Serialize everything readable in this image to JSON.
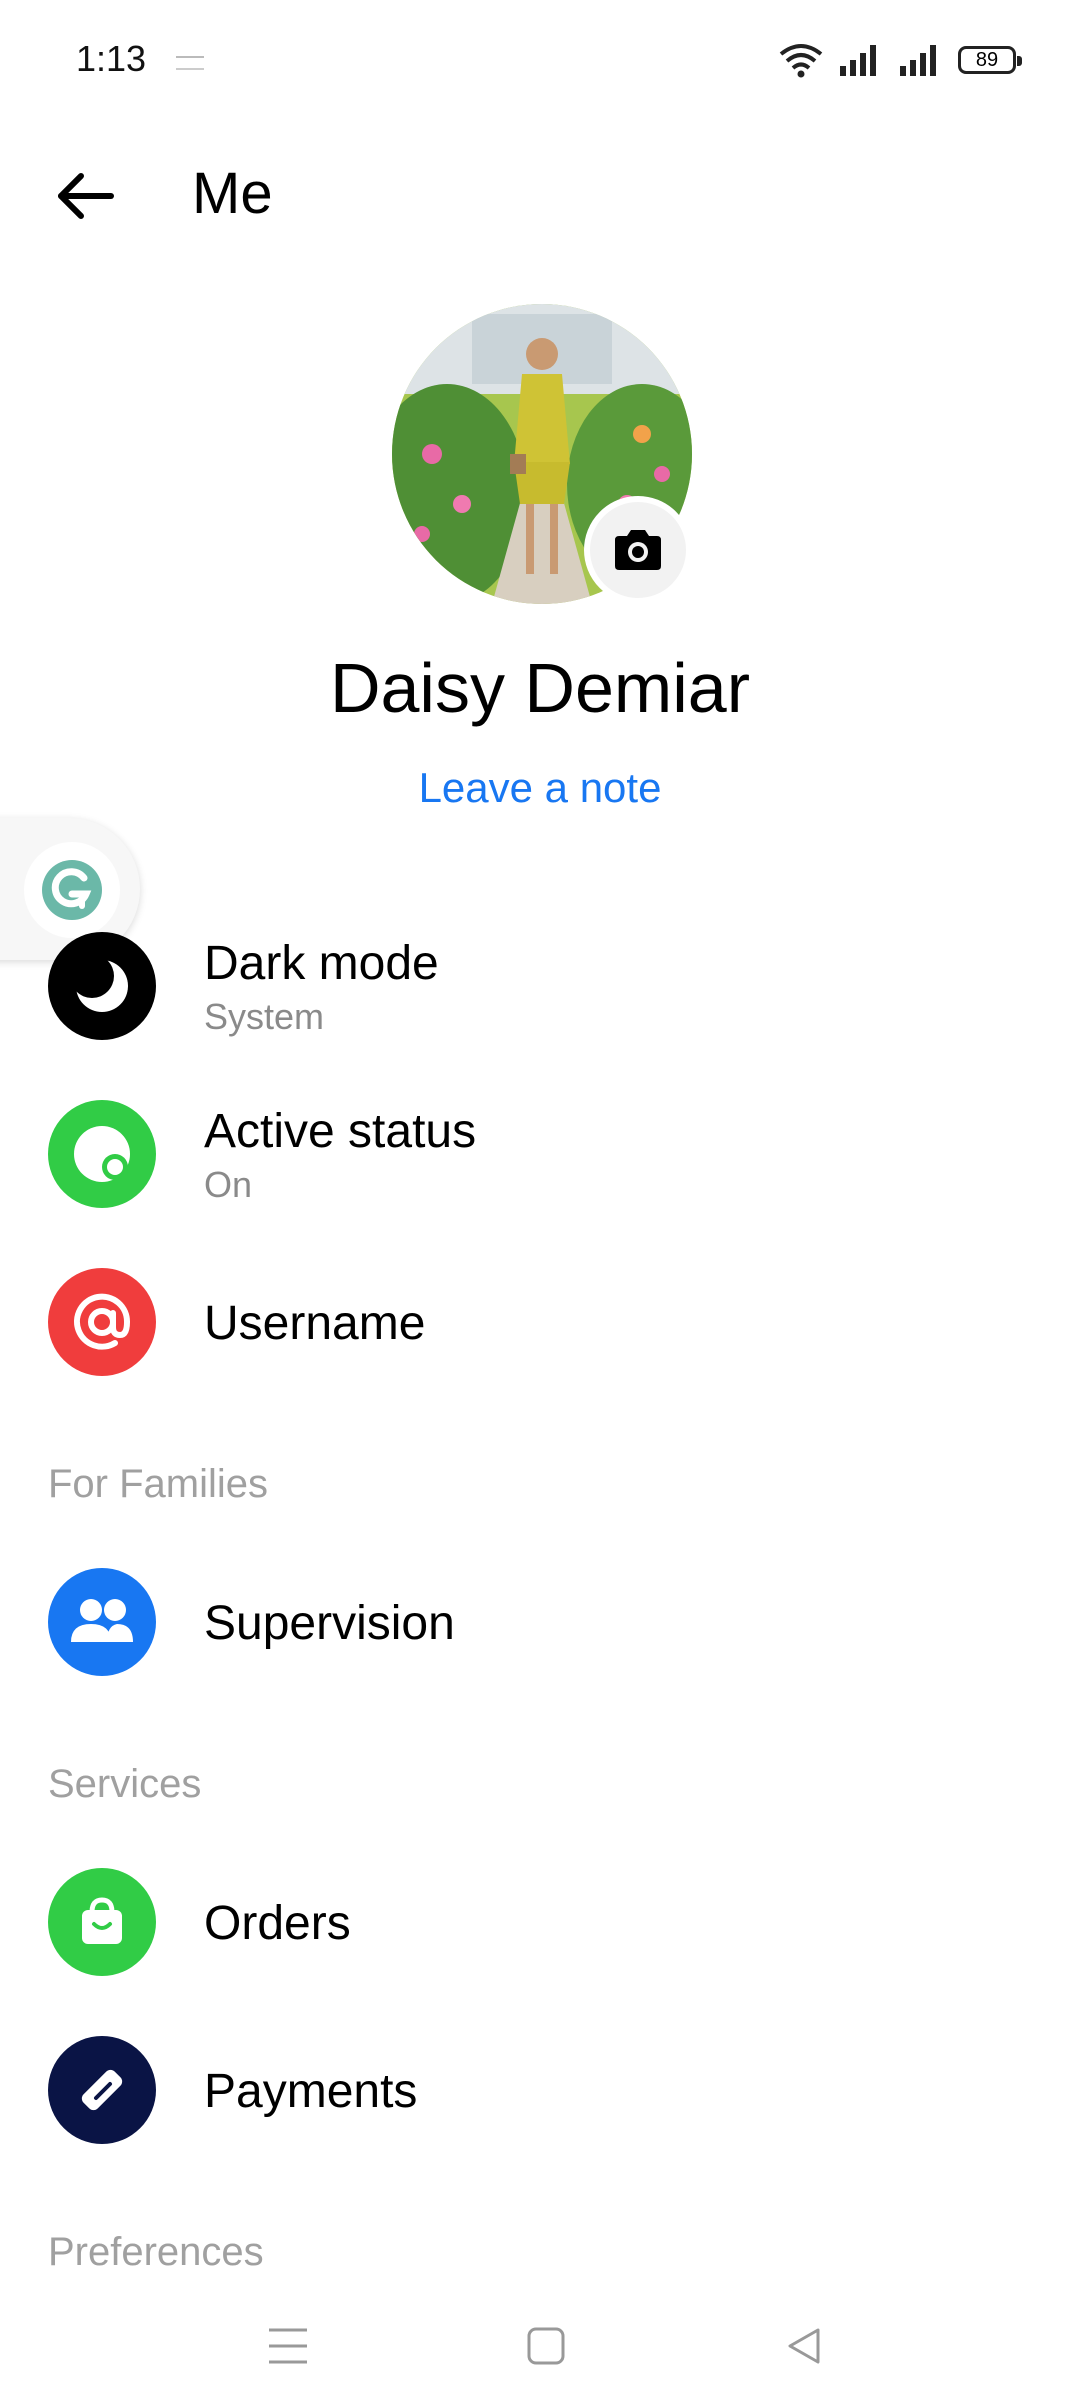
{
  "status_bar": {
    "time": "1:13",
    "battery": "89"
  },
  "header": {
    "title": "Me"
  },
  "profile": {
    "name": "Daisy Demiar",
    "leave_note": "Leave a note"
  },
  "account_items": [
    {
      "title": "Dark mode",
      "subtitle": "System",
      "icon": "moon-icon",
      "color": "#000000"
    },
    {
      "title": "Active status",
      "subtitle": "On",
      "icon": "active-status-icon",
      "color": "#31cc46"
    },
    {
      "title": "Username",
      "subtitle": "",
      "icon": "at-sign-icon",
      "color": "#f03d3d"
    }
  ],
  "sections": [
    {
      "header": "For Families",
      "items": [
        {
          "title": "Supervision",
          "icon": "people-icon",
          "color": "#1877f2"
        }
      ]
    },
    {
      "header": "Services",
      "items": [
        {
          "title": "Orders",
          "icon": "shopping-bag-icon",
          "color": "#31cc46"
        },
        {
          "title": "Payments",
          "icon": "payment-tag-icon",
          "color": "#0a1445"
        }
      ]
    },
    {
      "header": "Preferences",
      "items": []
    }
  ],
  "colors": {
    "link": "#1877f2",
    "secondary_text": "#8a8a8a",
    "section_header": "#a0a0a0"
  }
}
